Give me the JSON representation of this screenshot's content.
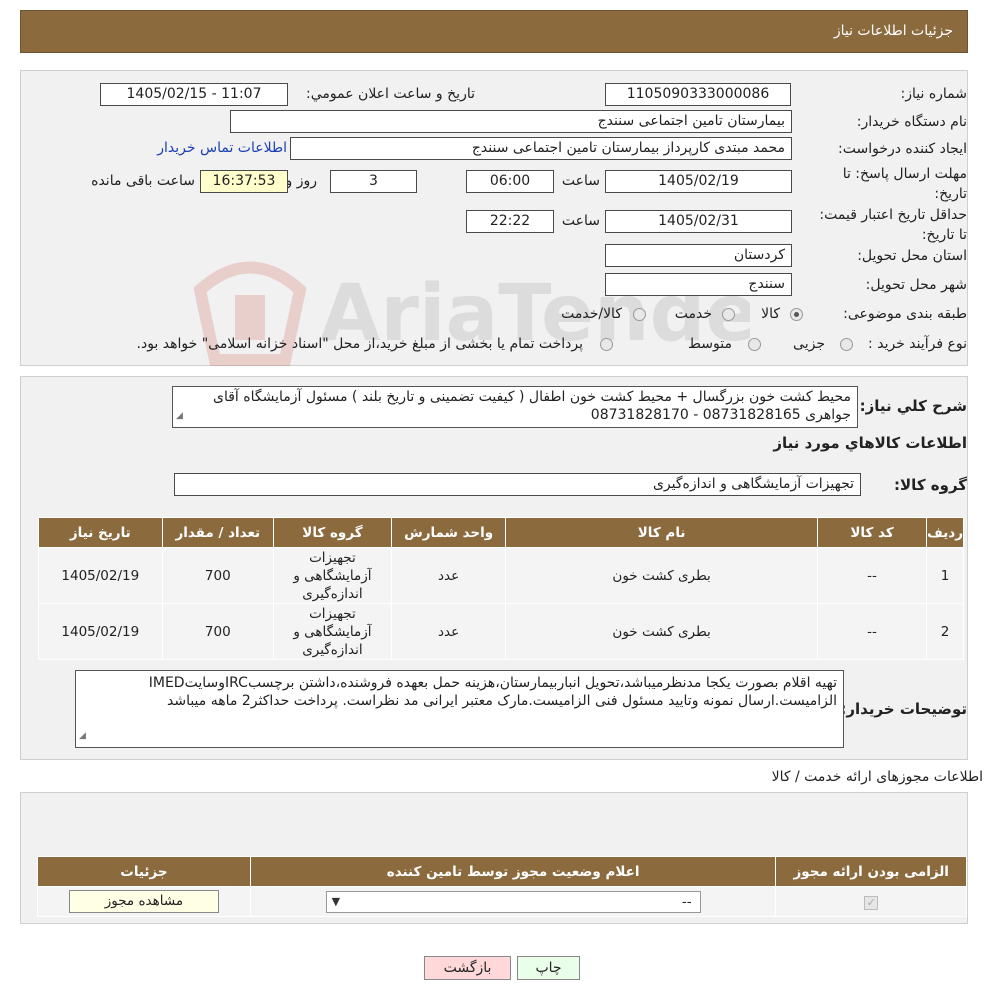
{
  "header": {
    "title": "جزئیات اطلاعات نیاز"
  },
  "fields": {
    "need_number_label": "شماره نیاز:",
    "need_number": "1105090333000086",
    "announce_label": "تاریخ و ساعت اعلان عمومي:",
    "announce_value": "1405/02/15 - 11:07",
    "buyer_label": "نام دستگاه خریدار:",
    "buyer_value": "بیمارستان تامین اجتماعی سنندج",
    "creator_label": "ایجاد کننده درخواست:",
    "creator_value": "محمد مبتدی کارپرداز بیمارستان تامین اجتماعی سنندج",
    "contact_link": "اطلاعات تماس خریدار",
    "deadline_label": "مهلت ارسال پاسخ: تا تاریخ:",
    "deadline_date": "1405/02/19",
    "time_label": "ساعت",
    "deadline_time": "06:00",
    "days_value": "3",
    "days_label": "روز و",
    "remaining_time": "16:37:53",
    "remaining_label": "ساعت باقی مانده",
    "validity_label": "حداقل تاریخ اعتبار قیمت: تا تاریخ:",
    "validity_date": "1405/02/31",
    "validity_time": "22:22",
    "province_label": "استان محل تحویل:",
    "province_value": "کردستان",
    "city_label": "شهر محل تحویل:",
    "city_value": "سنندج",
    "category_label": "طبقه بندی موضوعی:",
    "category_options": [
      "کالا",
      "خدمت",
      "کالا/خدمت"
    ],
    "category_selected": "کالا",
    "process_label": "نوع فرآیند خرید :",
    "process_options": [
      "جزیی",
      "متوسط"
    ],
    "process_note": "پرداخت تمام یا بخشی از مبلغ خرید،از محل \"اسناد خزانه اسلامی\" خواهد بود."
  },
  "summary": {
    "label": "شرح کلي نياز:",
    "text": "محیط کشت خون بزرگسال + محیط کشت خون اطفال ( کیفیت تضمینی و تاریخ بلند ) مسئول آزمایشگاه آقای جواهری 08731828165 - 08731828170"
  },
  "goods": {
    "section_title": "اطلاعات کالاهاي مورد نياز",
    "group_label": "گروه کالا:",
    "group_value": "تجهیزات آزمایشگاهی و اندازه‌گیری",
    "columns": [
      "رديف",
      "کد کالا",
      "نام کالا",
      "واحد شمارش",
      "گروه کالا",
      "تعداد / مقدار",
      "تاريخ نياز"
    ],
    "rows": [
      {
        "index": "1",
        "code": "--",
        "name": "بطری کشت خون",
        "unit": "عدد",
        "group": "تجهیزات آزمایشگاهی و اندازه‌گیری",
        "qty": "700",
        "date": "1405/02/19"
      },
      {
        "index": "2",
        "code": "--",
        "name": "بطری کشت خون",
        "unit": "عدد",
        "group": "تجهیزات آزمایشگاهی و اندازه‌گیری",
        "qty": "700",
        "date": "1405/02/19"
      }
    ]
  },
  "buyer_notes": {
    "label": "توضیحات خریدار:",
    "text": "تهیه اقلام بصورت یکجا مدنظرمیباشد،تحویل انباربیمارستان،هزینه حمل بعهده فروشنده،داشتن برچسبIRCوسایتIMED الزامیست.ارسال نمونه وتایید مسئول فنی الزامیست.مارک معتبر ایرانی مد نظراست. پرداخت حداکثر2 ماهه میباشد"
  },
  "permits": {
    "section_title": "اطلاعات مجوزهای ارائه خدمت / کالا",
    "columns": [
      "الزامی بودن ارائه مجوز",
      "اعلام وضعیت مجوز توسط تامین کننده",
      "جزئیات"
    ],
    "select_value": "--",
    "view_button": "مشاهده مجوز"
  },
  "actions": {
    "print": "چاپ",
    "back": "بازگشت"
  },
  "watermark": {
    "text": "AriaTender.neT"
  },
  "colors": {
    "header": "#8b6a3e",
    "link": "#1a3fb3",
    "back_button": "#ffd9d9",
    "print_button": "#eaffea"
  }
}
